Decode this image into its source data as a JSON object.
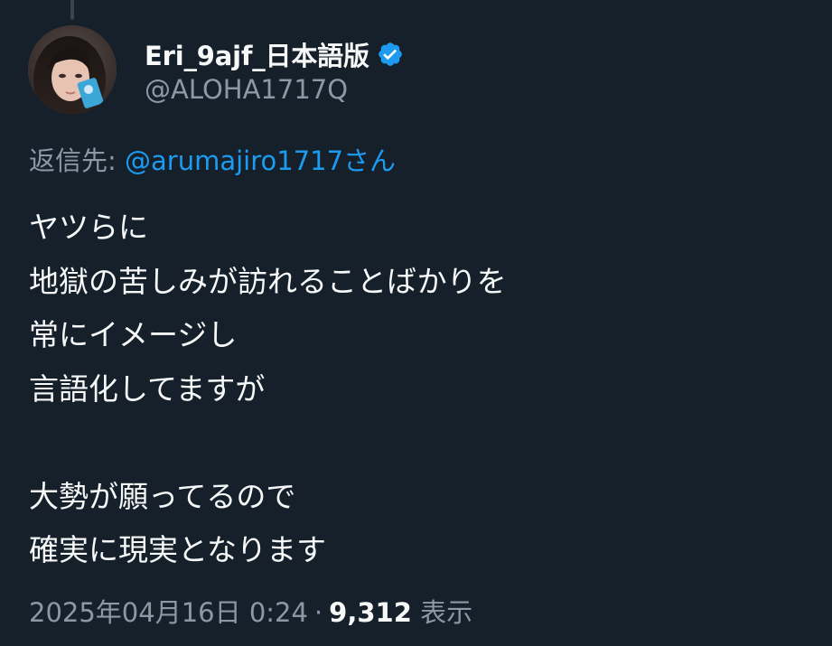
{
  "author": {
    "display_name": "Eri_9ajf_日本語版",
    "handle": "@ALOHA1717Q",
    "verified_icon": "verified-badge-icon",
    "verified_color": "#1d9bf0"
  },
  "reply_to": {
    "prefix": "返信先: ",
    "mention": "@arumajiro1717さん"
  },
  "body_lines": [
    "ヤツらに",
    "地獄の苦しみが訪れることばかりを",
    "常にイメージし",
    "言語化してますが",
    "",
    "大勢が願ってるので",
    "確実に現実となります"
  ],
  "meta": {
    "timestamp": "2025年04月16日 0:24",
    "separator": "·",
    "views_count": "9,312",
    "views_label": "表示"
  },
  "colors": {
    "background": "#15202b",
    "primary_text": "#f7f9f9",
    "secondary_text": "#8b98a5",
    "accent": "#1d9bf0"
  }
}
